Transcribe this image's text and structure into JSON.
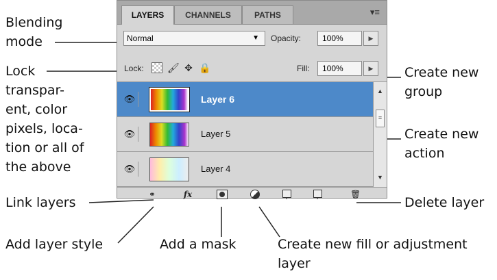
{
  "callouts": {
    "blending_mode": "Blending",
    "blending_mode_2": "mode",
    "lock_1": "Lock",
    "lock_2": "transpar-",
    "lock_3": "ent, color",
    "lock_4": "pixels, loca-",
    "lock_5": "tion or all of",
    "lock_6": "the above",
    "link_layers": "Link layers",
    "add_layer_style": "Add layer style",
    "add_mask": "Add a mask",
    "new_fill_1": "Create new fill or adjustment",
    "new_fill_2": "layer",
    "new_group_1": "Create new",
    "new_group_2": "group",
    "new_action_1": "Create new",
    "new_action_2": "action",
    "delete_layer": "Delete layer"
  },
  "panel": {
    "tabs": [
      "LAYERS",
      "CHANNELS",
      "PATHS"
    ],
    "menu_icon": "≡",
    "blend_mode": "Normal",
    "opacity_label": "Opacity:",
    "opacity_value": "100%",
    "lock_label": "Lock:",
    "fill_label": "Fill:",
    "fill_value": "100%",
    "layers": [
      {
        "name": "Layer 6",
        "selected": true
      },
      {
        "name": "Layer 5",
        "selected": false
      },
      {
        "name": "Layer 4",
        "selected": false
      }
    ],
    "bottom_icons": [
      "link-icon",
      "fx-icon",
      "mask-icon",
      "adjustment-icon",
      "folder-icon",
      "new-layer-icon",
      "trash-icon"
    ],
    "fx_label": "fx"
  },
  "colors": {
    "selected_row": "#4d89c9",
    "panel_bg": "#d6d6d6"
  }
}
